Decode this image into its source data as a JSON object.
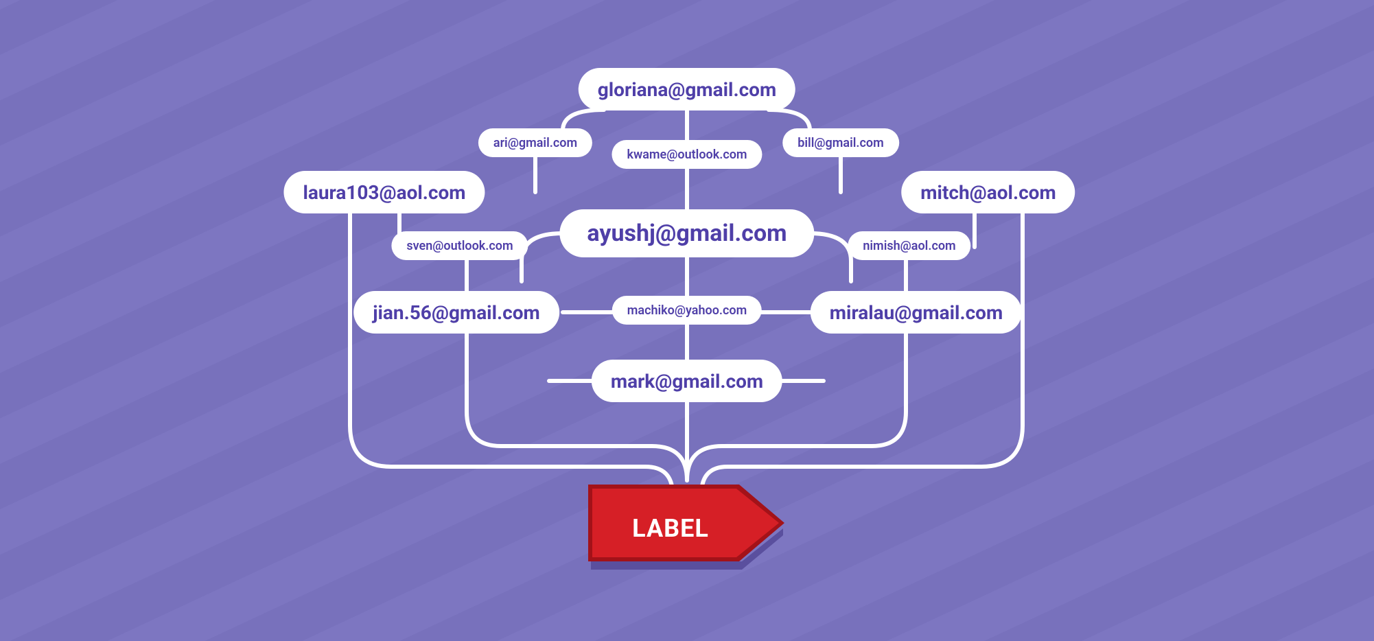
{
  "label": "LABEL",
  "emails": {
    "gloriana": "gloriana@gmail.com",
    "ari": "ari@gmail.com",
    "kwame": "kwame@outlook.com",
    "bill": "bill@gmail.com",
    "laura": "laura103@aol.com",
    "mitch": "mitch@aol.com",
    "sven": "sven@outlook.com",
    "ayushj": "ayushj@gmail.com",
    "nimish": "nimish@aol.com",
    "jian": "jian.56@gmail.com",
    "machiko": "machiko@yahoo.com",
    "miralau": "miralau@gmail.com",
    "mark": "mark@gmail.com"
  },
  "colors": {
    "background": "#7a73c0",
    "pill_bg": "#ffffff",
    "pill_text": "#4f3fa8",
    "connector": "#ffffff",
    "label_red": "#d61f26",
    "label_red_dark": "#a31219"
  }
}
